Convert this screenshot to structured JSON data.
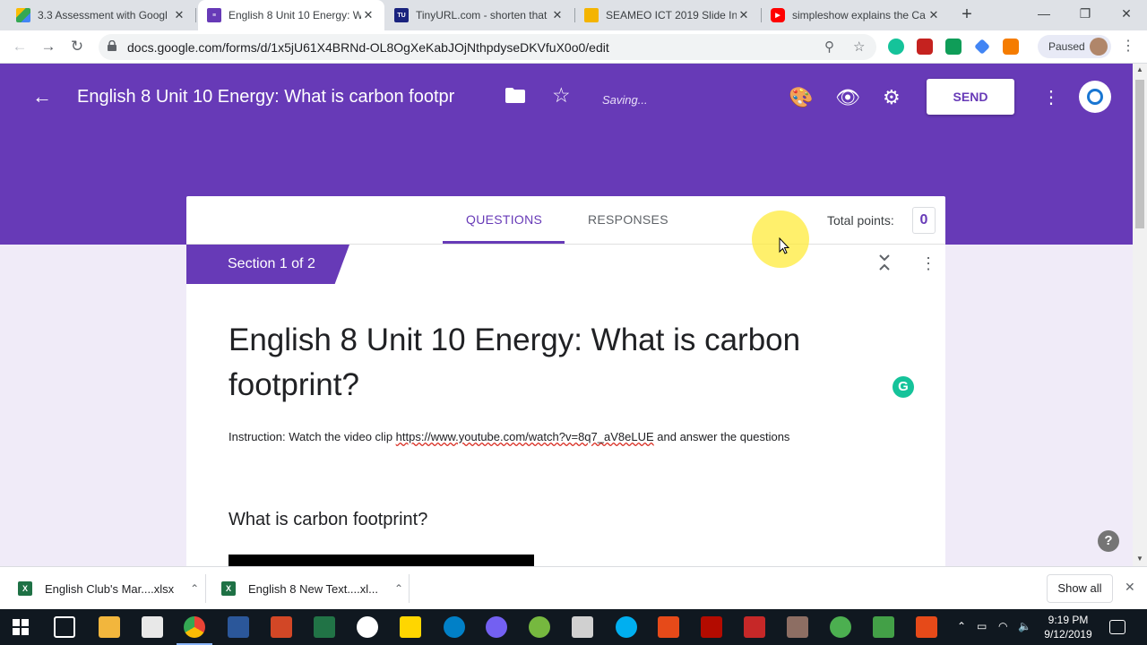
{
  "browser": {
    "tabs": [
      {
        "title": "3.3 Assessment with Googl",
        "icon": "google-drive-icon",
        "active": false
      },
      {
        "title": "English 8 Unit 10 Energy: W",
        "icon": "google-forms-icon",
        "active": true
      },
      {
        "title": "TinyURL.com - shorten that",
        "icon": "tinyurl-icon",
        "active": false
      },
      {
        "title": "SEAMEO ICT 2019 Slide Inst",
        "icon": "google-slides-icon",
        "active": false
      },
      {
        "title": "simpleshow explains the Ca",
        "icon": "youtube-icon",
        "active": false
      }
    ],
    "url": "docs.google.com/forms/d/1x5jU61X4BRNd-OL8OgXeKabJOjNthpdyseDKVfuX0o0/edit",
    "profile_status": "Paused",
    "colors": {
      "tabstrip": "#dee1e6",
      "omnibox": "#f1f3f4"
    }
  },
  "forms_header": {
    "title": "English 8 Unit 10 Energy: What is carbon footpr",
    "status": "Saving...",
    "send_label": "SEND",
    "accent_color": "#673ab7"
  },
  "form_tabs": {
    "questions": "QUESTIONS",
    "responses": "RESPONSES",
    "total_points_label": "Total points:",
    "total_points_value": "0"
  },
  "section": {
    "badge": "Section 1 of 2",
    "title": "English 8 Unit 10 Energy: What is carbon footprint?",
    "instruction_prefix": "Instruction: Watch the video clip ",
    "instruction_link": "https://www.youtube.com/watch?v=8q7_aV8eLUE",
    "instruction_suffix": " and answer the questions",
    "question": "What is carbon footprint?"
  },
  "downloads": [
    {
      "name": "English Club's Mar....xlsx"
    },
    {
      "name": "English 8 New Text....xl..."
    }
  ],
  "download_bar": {
    "show_all": "Show all"
  },
  "taskbar": {
    "time": "9:19 PM",
    "date": "9/12/2019"
  }
}
